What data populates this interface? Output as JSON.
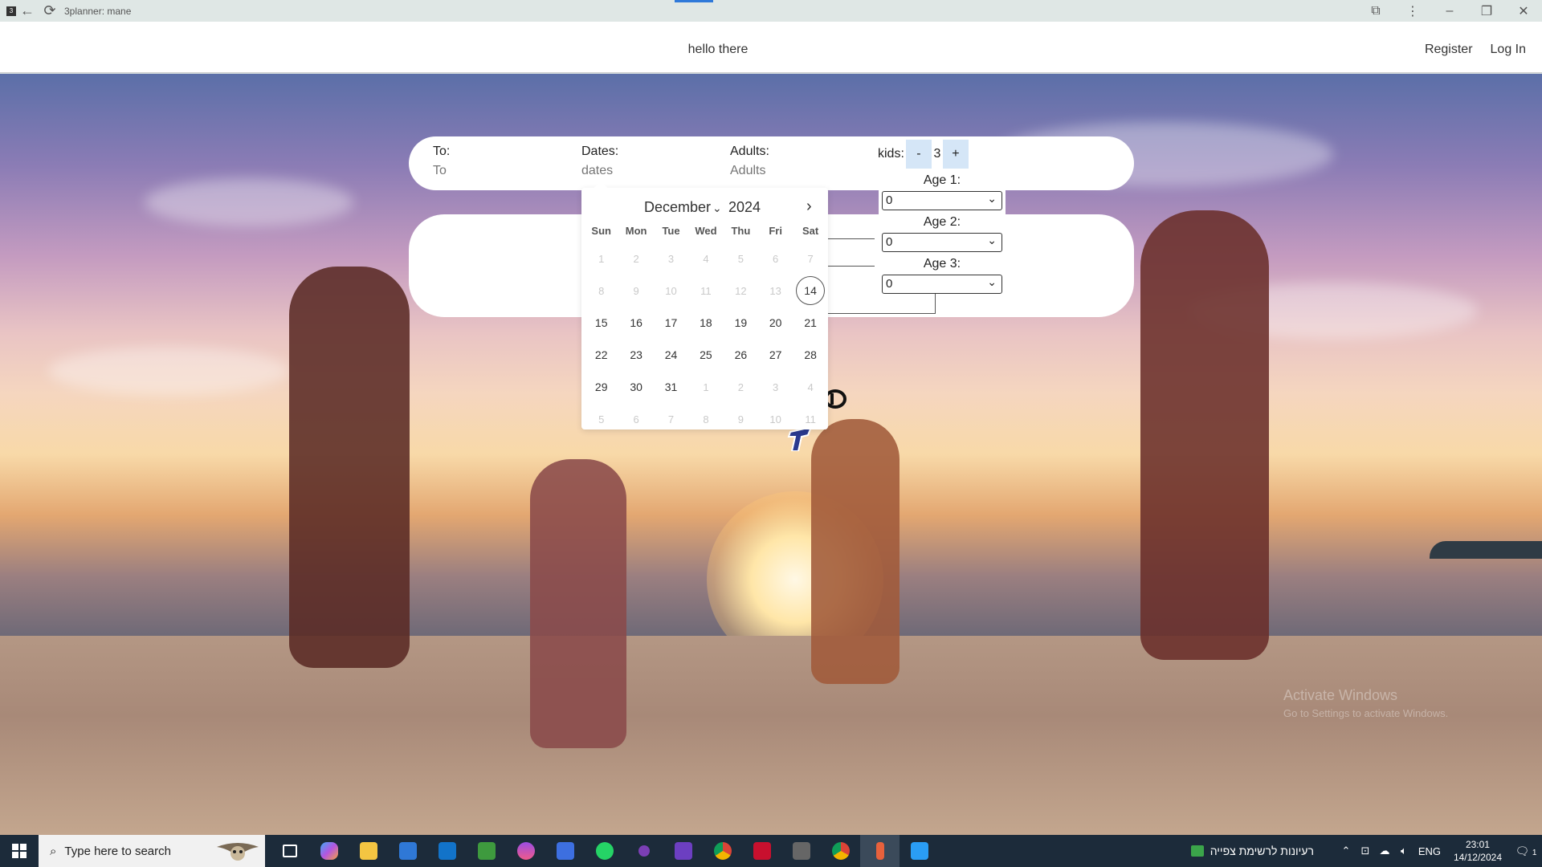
{
  "window": {
    "app_title": "3planner: mane"
  },
  "header": {
    "greeting": "hello there",
    "register_label": "Register",
    "login_label": "Log In"
  },
  "search": {
    "to_label": "To:",
    "to_placeholder": "To",
    "dates_label": "Dates:",
    "dates_placeholder": "dates",
    "adults_label": "Adults:",
    "adults_placeholder": "Adults",
    "kids_label": "kids:",
    "kids_minus": "-",
    "kids_plus": "+",
    "kids_count": "3"
  },
  "ages": [
    {
      "label": "Age 1:",
      "value": "0"
    },
    {
      "label": "Age 2:",
      "value": "0"
    },
    {
      "label": "Age 3:",
      "value": "0"
    }
  ],
  "calendar": {
    "month": "December",
    "year": "2024",
    "next_icon": "chevron-right-icon",
    "weekdays": [
      "Sun",
      "Mon",
      "Tue",
      "Wed",
      "Thu",
      "Fri",
      "Sat"
    ],
    "weeks": [
      [
        "1",
        "2",
        "3",
        "4",
        "5",
        "6",
        "7"
      ],
      [
        "8",
        "9",
        "10",
        "11",
        "12",
        "13",
        "14"
      ],
      [
        "15",
        "16",
        "17",
        "18",
        "19",
        "20",
        "21"
      ],
      [
        "22",
        "23",
        "24",
        "25",
        "26",
        "27",
        "28"
      ],
      [
        "29",
        "30",
        "31",
        "1",
        "2",
        "3",
        "4"
      ],
      [
        "5",
        "6",
        "7",
        "8",
        "9",
        "10",
        "11"
      ]
    ],
    "today": "14"
  },
  "watermark": {
    "title": "Activate Windows",
    "subtitle": "Go to Settings to activate Windows."
  },
  "taskbar": {
    "search_placeholder": "Type here to search",
    "news_text": "רעיונות לרשימת צפייה",
    "language": "ENG",
    "time": "23:01",
    "date": "14/12/2024",
    "notification_count": "1",
    "accent": "#1c2b3a"
  }
}
